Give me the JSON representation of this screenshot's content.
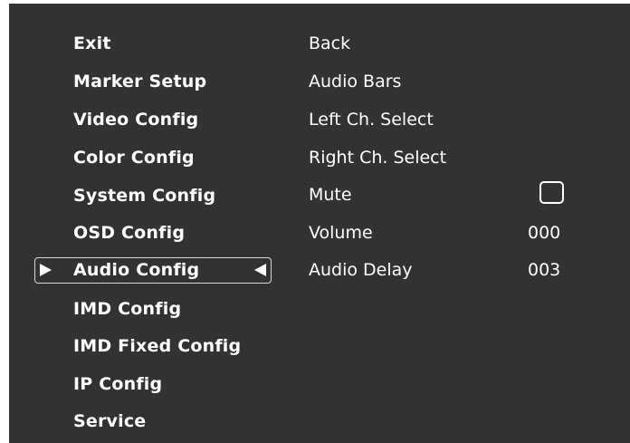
{
  "menu": {
    "items": [
      {
        "label": "Exit"
      },
      {
        "label": "Marker Setup"
      },
      {
        "label": "Video Config"
      },
      {
        "label": "Color Config"
      },
      {
        "label": "System Config"
      },
      {
        "label": "OSD Config"
      },
      {
        "label": "Audio Config"
      },
      {
        "label": "IMD Config"
      },
      {
        "label": "IMD Fixed Config"
      },
      {
        "label": "IP Config"
      },
      {
        "label": "Service"
      }
    ],
    "selected": "Audio Config"
  },
  "submenu": {
    "items": [
      {
        "label": "Back"
      },
      {
        "label": "Audio Bars"
      },
      {
        "label": "Left Ch. Select"
      },
      {
        "label": "Right Ch. Select"
      },
      {
        "label": "Mute",
        "checked": false
      },
      {
        "label": "Volume",
        "value": "000"
      },
      {
        "label": "Audio Delay",
        "value": "003"
      }
    ]
  },
  "colors": {
    "background": "#323232",
    "text": "#ffffff",
    "selection_border": "#d8d8d8"
  }
}
